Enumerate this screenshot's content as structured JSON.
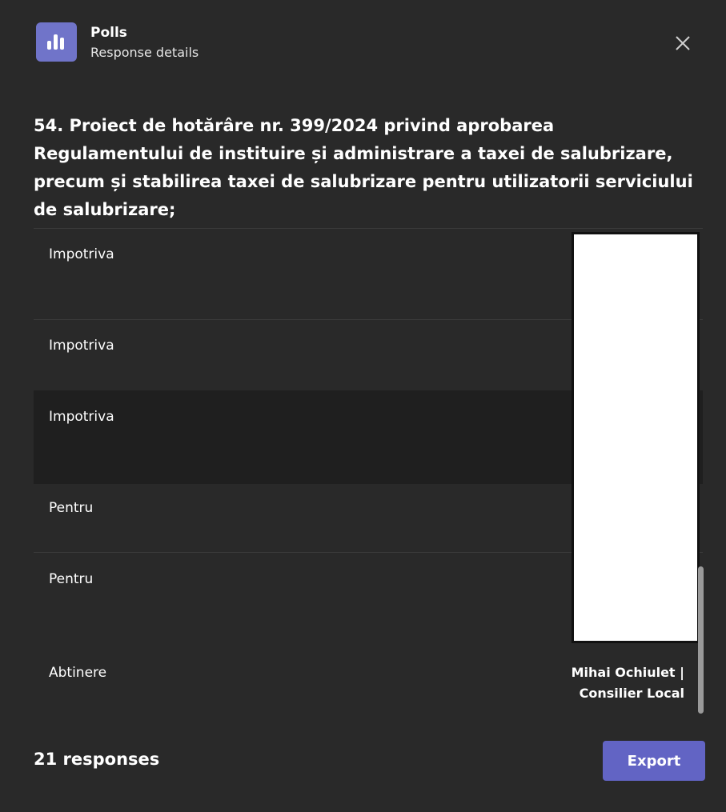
{
  "header": {
    "app_icon": "poll-chart-icon",
    "app_name": "Polls",
    "subtitle": "Response details",
    "close_icon": "close-icon"
  },
  "question": {
    "text": "54. Proiect de hotărâre nr. 399/2024 privind aprobarea Regulamentului de instituire și administrare a taxei de salubrizare, precum și stabilirea taxei de salubrizare pentru utilizatorii serviciului de salubrizare;"
  },
  "responses": [
    {
      "answer": "Impotriva"
    },
    {
      "answer": "Impotriva"
    },
    {
      "answer": "Impotriva"
    },
    {
      "answer": "Pentru"
    },
    {
      "answer": "Pentru"
    },
    {
      "answer": "Abtinere",
      "responder_line1": "Mihai Ochiulet |",
      "responder_line2": "Consilier Local"
    }
  ],
  "footer": {
    "response_count": "21 responses",
    "export_label": "Export"
  },
  "colors": {
    "background": "#292929",
    "accent": "#6264c4",
    "app_icon_bg": "#7074c9",
    "row_highlight": "#1f1f1f"
  }
}
